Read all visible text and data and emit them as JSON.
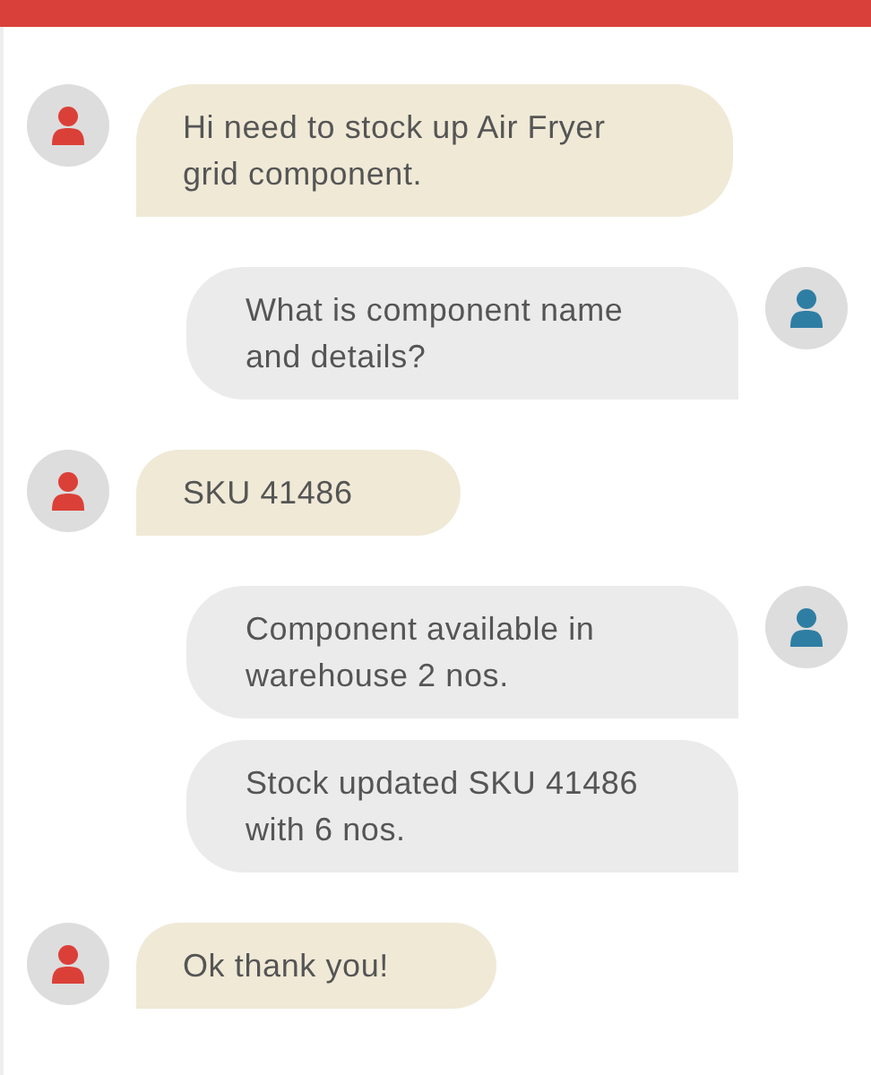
{
  "messages": [
    {
      "kind": "incoming",
      "show_avatar": true,
      "text": "Hi need to stock up Air Fryer grid component."
    },
    {
      "kind": "outgoing",
      "show_avatar": true,
      "text": "What is component name and details?"
    },
    {
      "kind": "incoming",
      "show_avatar": true,
      "text": "SKU 41486"
    },
    {
      "kind": "outgoing",
      "show_avatar": true,
      "text": "Component available in warehouse 2 nos."
    },
    {
      "kind": "outgoing",
      "show_avatar": false,
      "text": "Stock updated SKU 41486 with 6 nos."
    },
    {
      "kind": "incoming",
      "show_avatar": true,
      "text": "Ok thank you!"
    }
  ]
}
